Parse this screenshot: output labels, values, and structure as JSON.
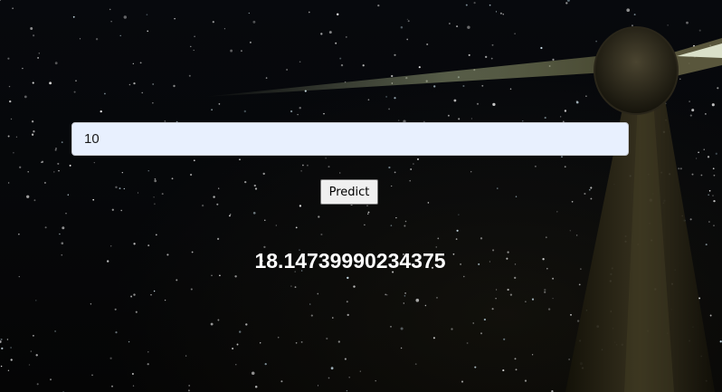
{
  "form": {
    "input_value": "10",
    "predict_label": "Predict"
  },
  "result": {
    "value": "18.14739990234375"
  },
  "background": {
    "description_icon": "night-sky-wind-turbine-image",
    "accent": "#e8f0fe"
  }
}
